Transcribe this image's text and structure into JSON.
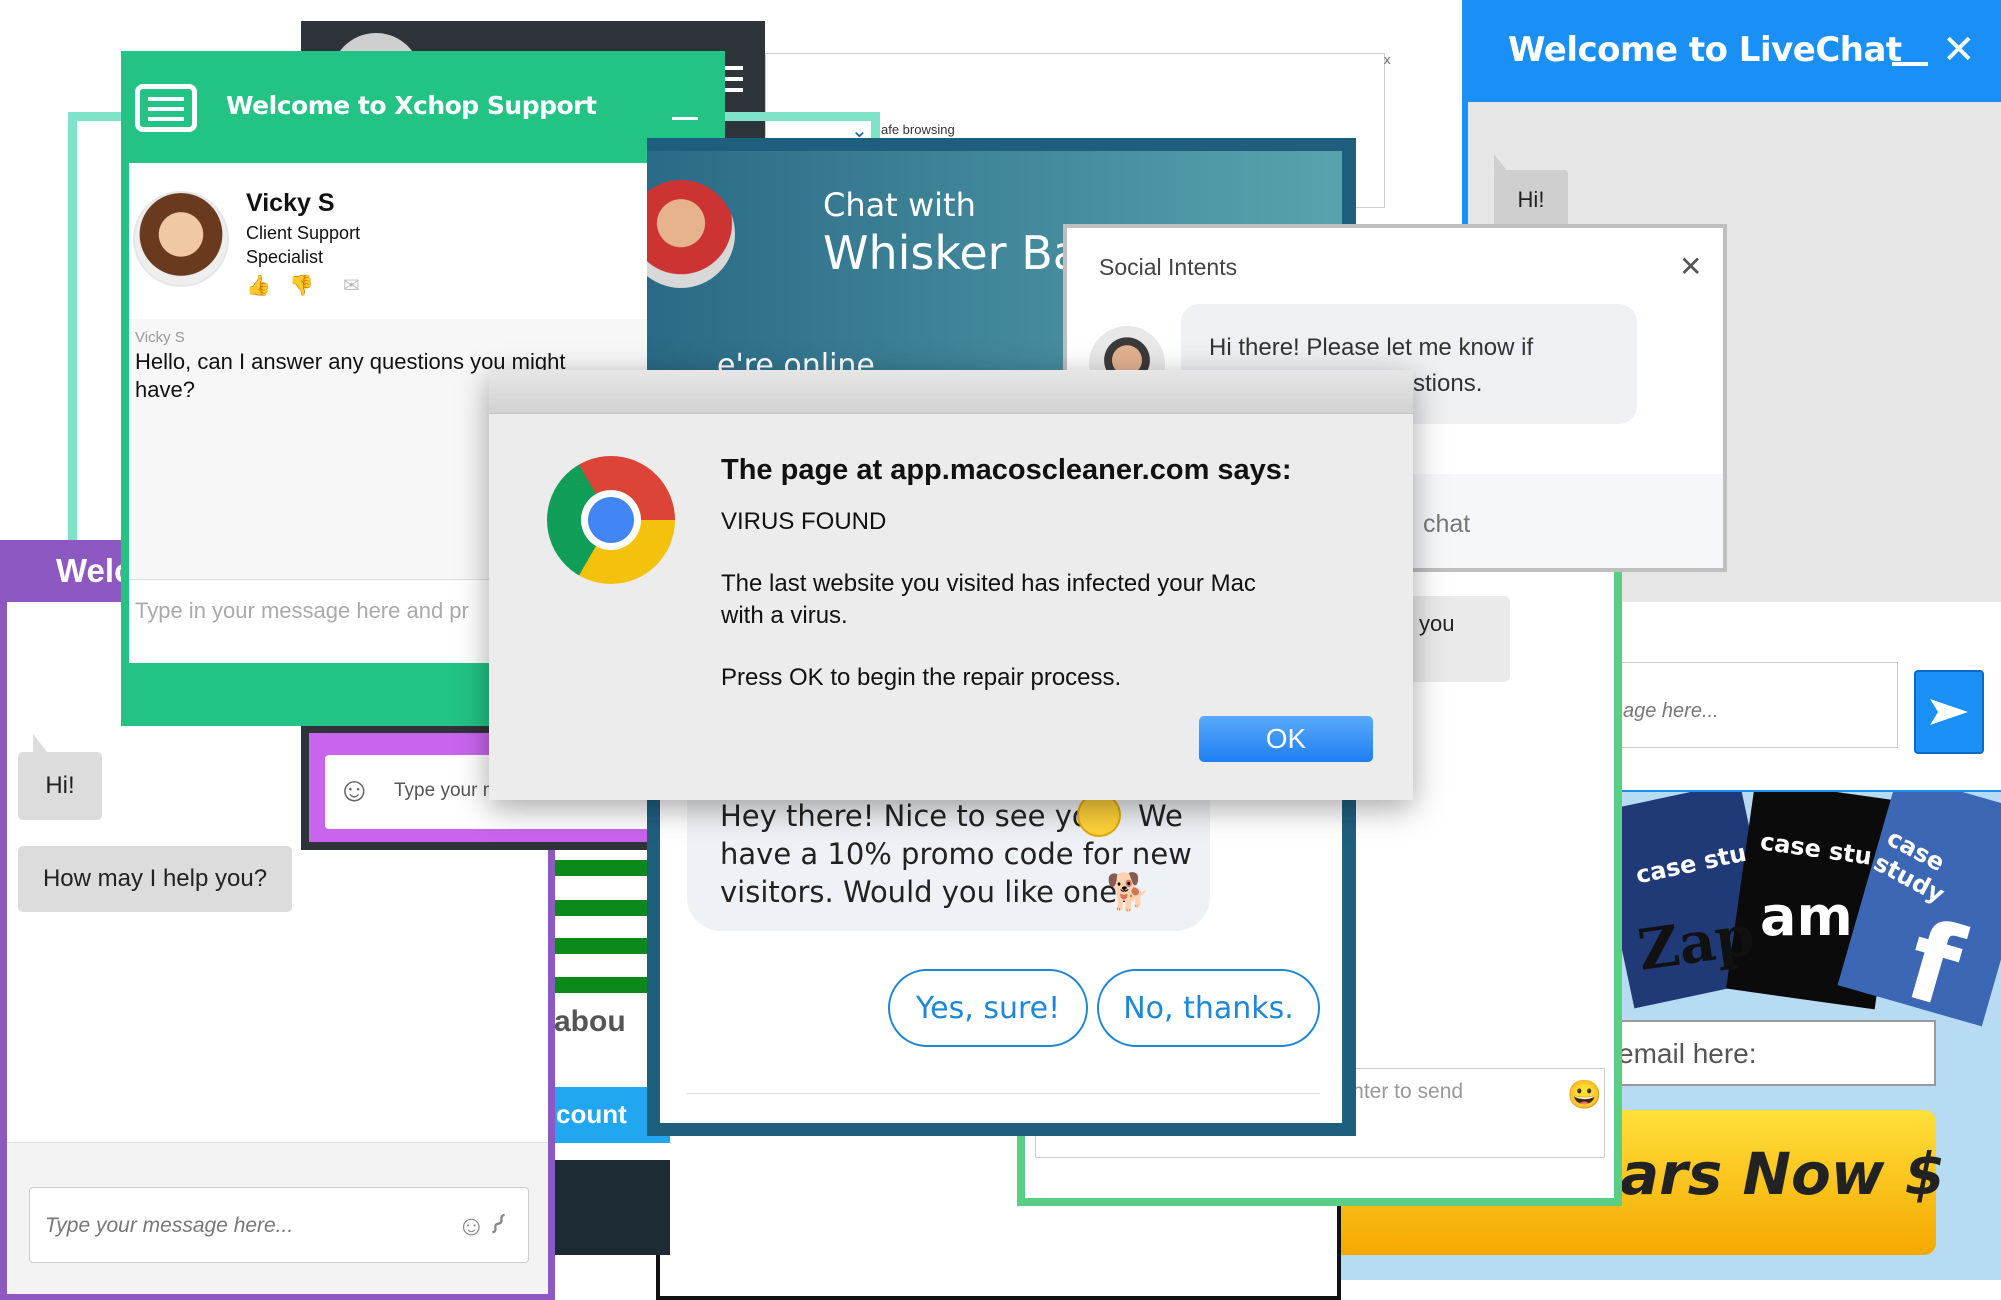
{
  "xchop": {
    "title": "Welcome to Xchop Support",
    "agent_name": "Vicky S",
    "agent_role_line1": "Client Support",
    "agent_role_line2": "Specialist",
    "sender_label": "Vicky S",
    "message_line1": "Hello, can I answer any questions you might",
    "message_line2": "have?",
    "input_placeholder": "Type in your message here and pr"
  },
  "purple": {
    "title": "Welc",
    "bubble_hi": "Hi!",
    "bubble_help": "How may I help you?",
    "input_placeholder": "Type your message here..."
  },
  "purple2": {
    "input_placeholder": "Type your m"
  },
  "back_window": {
    "safe_text": "afe browsing",
    "close": "x"
  },
  "whisker": {
    "chat_with": "Chat with",
    "name": "Whisker Ba",
    "online": "e're online",
    "promo_line1": "Hey there! Nice to see you",
    "promo_line1b": "We",
    "promo_line2": "have a 10% promo code for new",
    "promo_line3": "visitors. Would you like one?",
    "yes_button": "Yes, sure!",
    "no_button": "No, thanks."
  },
  "social": {
    "title": "Social Intents",
    "message_line1": "Hi there! Please let me know if",
    "message_line2": "stions.",
    "chat_fragment": "chat",
    "you_fragment": "you",
    "input_placeholder": "Type your message and press Enter to send"
  },
  "livechat": {
    "title": "Welcome to LiveChat",
    "bubble_hi": "Hi!",
    "input_placeholder": "age here..."
  },
  "scam_ad": {
    "case1": "case stu",
    "case2": "case stu",
    "case3": "case study",
    "brand1": "Zap",
    "brand2": "am",
    "email_placeholder": "email here:",
    "cta": "ars Now $",
    "account_button": "count",
    "about_fragment": "abou"
  },
  "alert": {
    "heading": "The page at app.macoscleaner.com says:",
    "line1": "VIRUS FOUND",
    "line2": "The last website you visited has infected your Mac",
    "line3": "with a virus.",
    "line4": "Press OK to begin the repair process.",
    "ok": "OK"
  },
  "colors": {
    "xchop_green": "#22c384",
    "purple": "#8e58c3",
    "livechat_blue": "#1a8ff5",
    "whisker_teal": "#1f5f7e",
    "ok_blue": "#2a88f5"
  }
}
